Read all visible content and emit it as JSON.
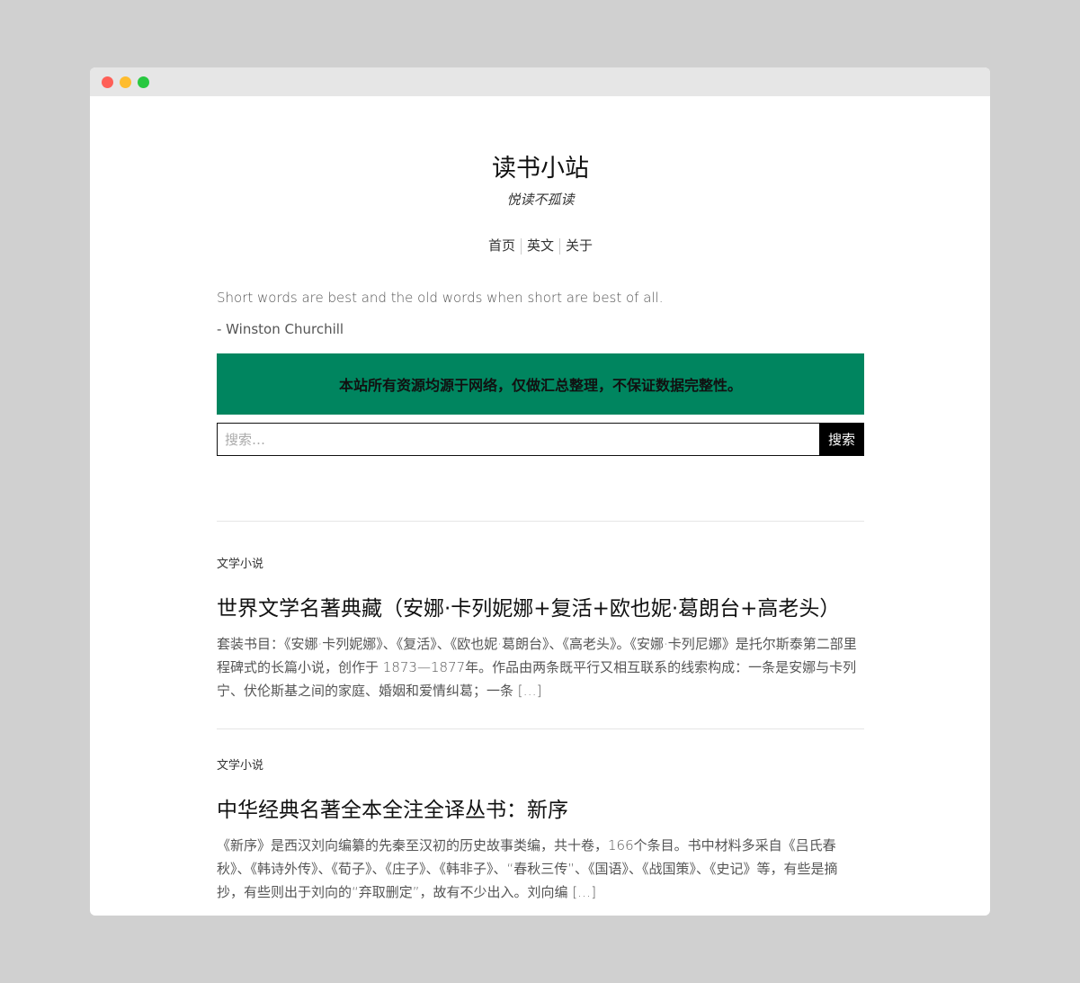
{
  "site": {
    "title": "读书小站",
    "tagline": "悦读不孤读"
  },
  "nav": {
    "items": [
      {
        "label": "首页"
      },
      {
        "label": "英文"
      },
      {
        "label": "关于"
      }
    ]
  },
  "quote": {
    "text": "Short words are best and the old words when short are best of all.",
    "author": "- Winston Churchill"
  },
  "notice": {
    "text": "本站所有资源均源于网络，仅做汇总整理，不保证数据完整性。",
    "background": "#00855f"
  },
  "search": {
    "placeholder": "搜索…",
    "button_label": "搜索"
  },
  "posts": [
    {
      "category": "文学小说",
      "title": "世界文学名著典藏（安娜·卡列妮娜+复活+欧也妮·葛朗台+高老头）",
      "excerpt": "套装书目：《安娜·卡列妮娜》、《复活》、《欧也妮·葛朗台》、《高老头》。《安娜·卡列尼娜》是托尔斯泰第二部里程碑式的长篇小说，创作于 1873—1877年。作品由两条既平行又相互联系的线索构成：一条是安娜与卡列宁、伏伦斯基之间的家庭、婚姻和爱情纠葛；一条 […]"
    },
    {
      "category": "文学小说",
      "title": "中华经典名著全本全注全译丛书：新序",
      "excerpt": "《新序》是西汉刘向编纂的先秦至汉初的历史故事类编，共十卷，166个条目。书中材料多采自《吕氏春秋》、《韩诗外传》、《荀子》、《庄子》、《韩非子》、“春秋三传”、《国语》、《战国策》、《史记》等，有些是摘抄，有些则出于刘向的“弃取删定”，故有不少出入。刘向编 […]"
    }
  ]
}
